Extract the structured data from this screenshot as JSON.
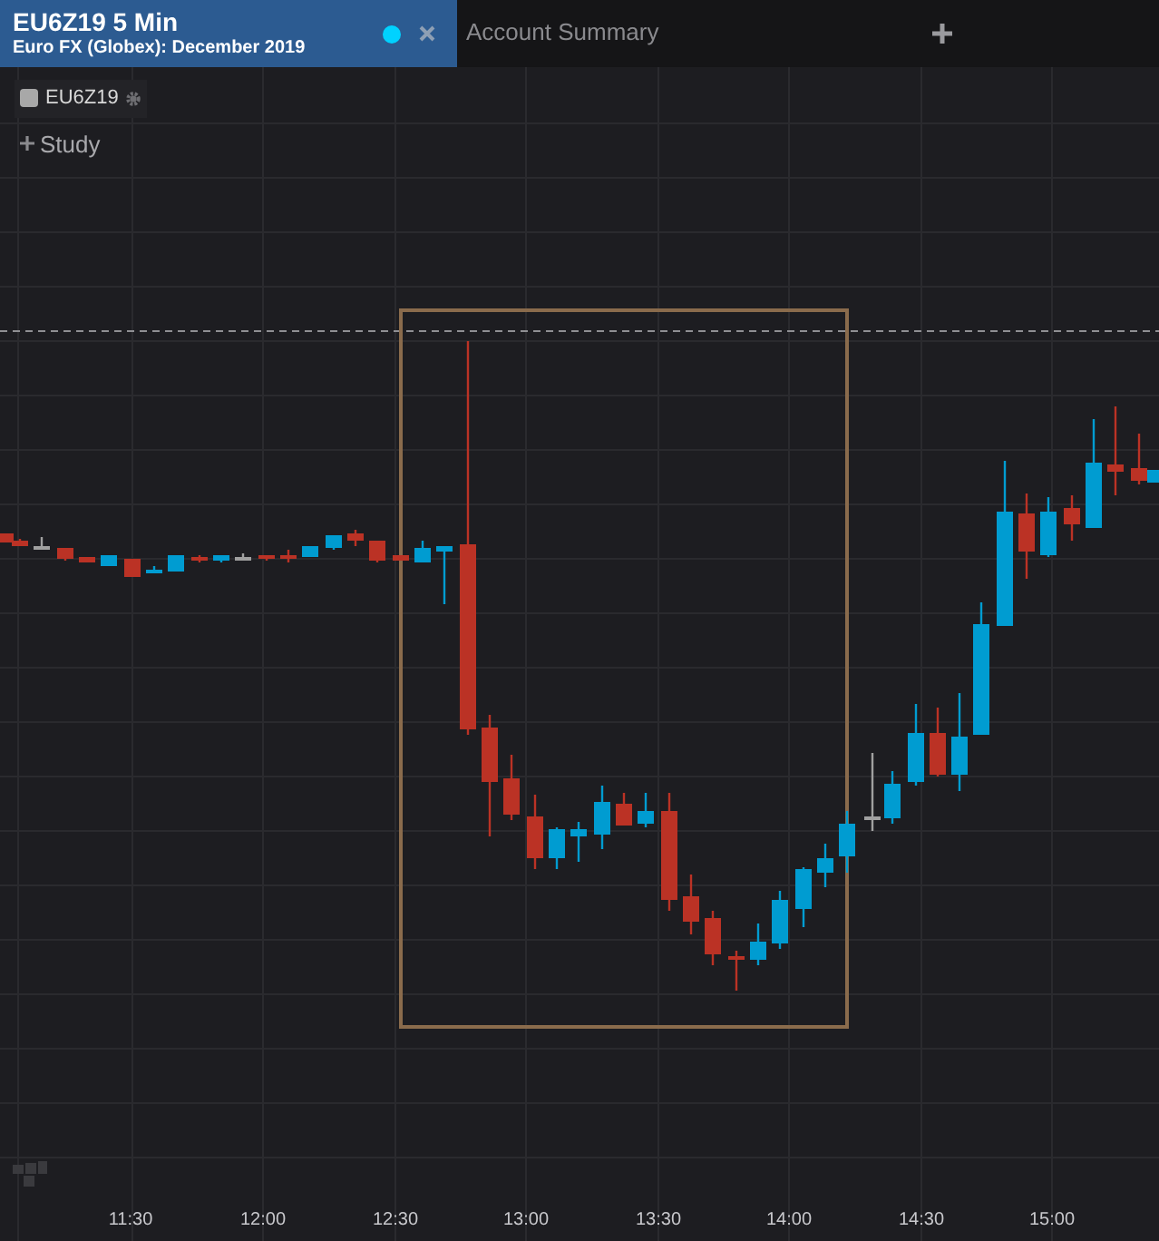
{
  "tabs": [
    {
      "title": "EU6Z19 5 Min",
      "subtitle": "Euro FX (Globex): December 2019",
      "selected": true,
      "live": true,
      "closable": true
    },
    {
      "title": "Account Summary",
      "selected": false,
      "live": false,
      "closable": false
    }
  ],
  "legend": {
    "symbol": "EU6Z19",
    "study_button": "Study"
  },
  "x_axis_labels": [
    "11:30",
    "12:00",
    "12:30",
    "13:00",
    "13:30",
    "14:00",
    "14:30",
    "15:00"
  ]
}
